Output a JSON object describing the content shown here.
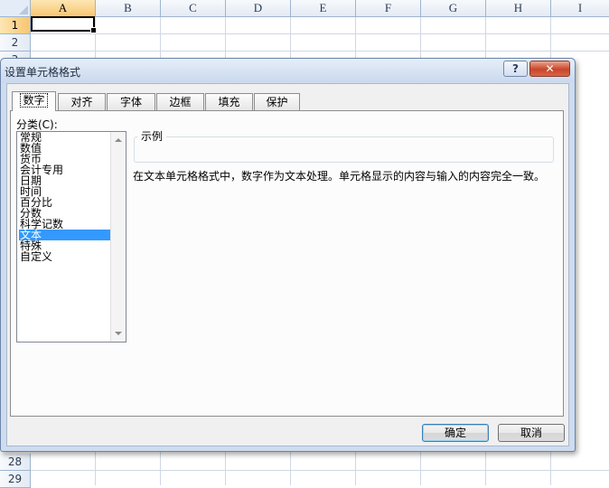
{
  "sheet": {
    "columns": [
      "A",
      "B",
      "C",
      "D",
      "E",
      "F",
      "G",
      "H",
      "I"
    ],
    "rows_top": [
      "1",
      "2",
      "3"
    ],
    "rows_bottom": [
      "28",
      "29"
    ],
    "active_column": "A",
    "active_row": "1"
  },
  "dialog": {
    "title": "设置单元格格式",
    "help_label": "?",
    "close_label": "✕",
    "tabs": [
      {
        "label": "数字",
        "selected": true
      },
      {
        "label": "对齐",
        "selected": false
      },
      {
        "label": "字体",
        "selected": false
      },
      {
        "label": "边框",
        "selected": false
      },
      {
        "label": "填充",
        "selected": false
      },
      {
        "label": "保护",
        "selected": false
      }
    ],
    "category_label": "分类(C):",
    "categories": [
      "常规",
      "数值",
      "货币",
      "会计专用",
      "日期",
      "时间",
      "百分比",
      "分数",
      "科学记数",
      "文本",
      "特殊",
      "自定义"
    ],
    "selected_category": "文本",
    "sample_label": "示例",
    "description": "在文本单元格格式中，数字作为文本处理。单元格显示的内容与输入的内容完全一致。",
    "ok_label": "确定",
    "cancel_label": "取消"
  },
  "icons": {
    "scroll_up": "scroll-up-arrow-icon",
    "scroll_down": "scroll-down-arrow-icon"
  },
  "colors": {
    "selection": "#3399ff",
    "active_header": "#f8c672",
    "close_button": "#c8462a"
  }
}
